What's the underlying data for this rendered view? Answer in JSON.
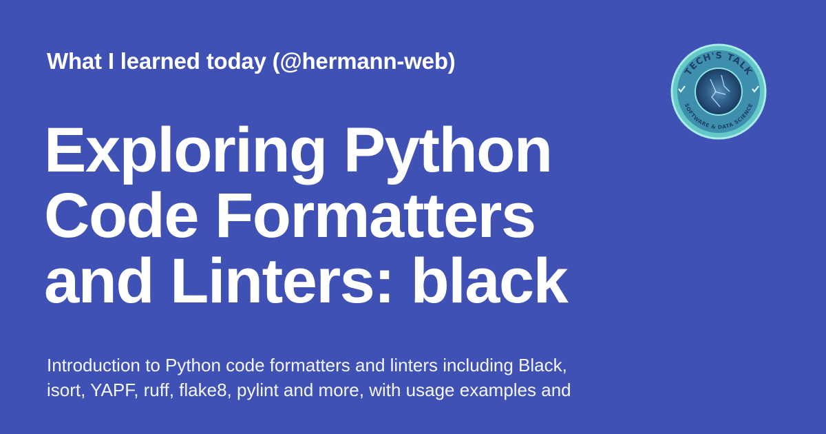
{
  "header": {
    "kicker": "What I learned today (@hermann-web)"
  },
  "post": {
    "title_lines": [
      "Exploring Python",
      "Code Formatters",
      "and Linters: black"
    ],
    "description_lines": [
      "Introduction to Python code formatters and linters including Black,",
      "isort, YAPF, ruff, flake8, pylint and more, with usage examples and"
    ]
  },
  "logo": {
    "top_text": "TECH'S TALK",
    "bottom_text": "SOFTWARE & DATA SCIENCE",
    "icon": "check-icon"
  },
  "colors": {
    "background": "#3f51b5",
    "text": "#ffffff",
    "logo_ring": "#6fd3cf",
    "logo_inner": "#2a4f7a"
  }
}
